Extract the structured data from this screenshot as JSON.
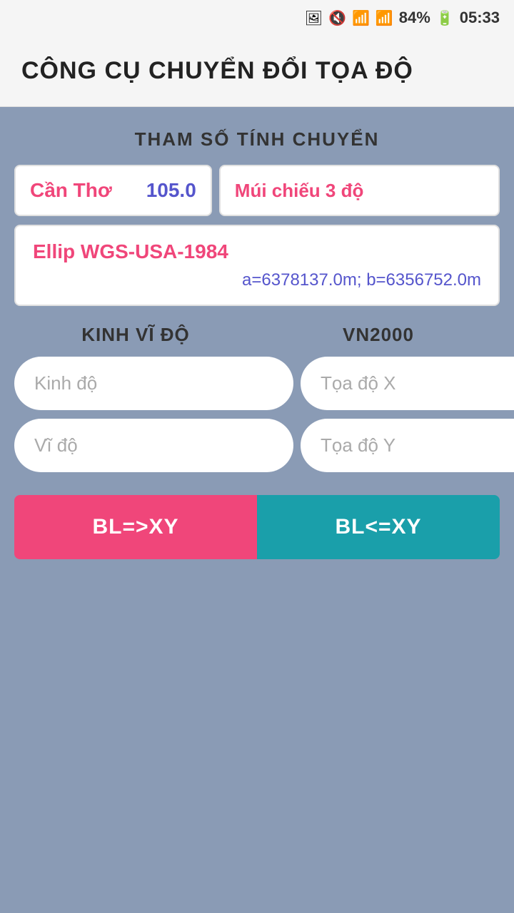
{
  "statusBar": {
    "mute": "🔇",
    "wifi": "📶",
    "signal": "📶",
    "battery": "84%",
    "batteryIcon": "🔋",
    "time": "05:33"
  },
  "appBar": {
    "title": "CÔNG CỤ CHUYỂN ĐỔI TỌA ĐỘ"
  },
  "params": {
    "sectionLabel": "THAM SỐ TÍNH CHUYỂN",
    "cityName": "Cần Thơ",
    "cityValue": "105.0",
    "muiChieu": "Múi chiếu 3 độ",
    "ellipTitle": "Ellip WGS-USA-1984",
    "ellipParams": "a=6378137.0m; b=6356752.0m"
  },
  "columns": {
    "left": "KINH VĨ ĐỘ",
    "right": "VN2000"
  },
  "inputs": {
    "kinhDo": "Kinh độ",
    "viDo": "Vĩ độ",
    "toaDox": "Tọa độ X",
    "toaDoy": "Tọa độ Y"
  },
  "buttons": {
    "blToXy": "BL=>XY",
    "xyToBl": "BL<=XY"
  }
}
